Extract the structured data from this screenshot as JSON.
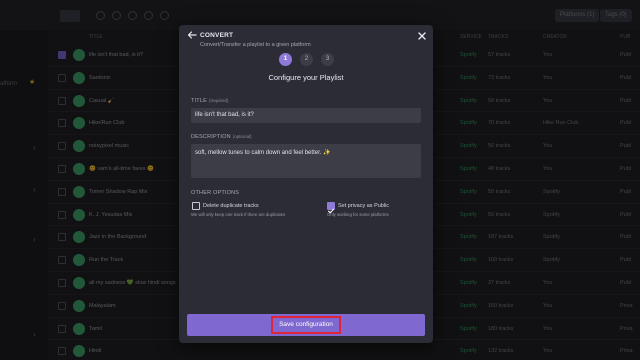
{
  "background": {
    "topbar": {
      "pills": [
        "Platforms (1)",
        "Tags (0)"
      ]
    },
    "sidebar": {
      "item": "atform"
    },
    "columns": [
      "TITLE",
      "SERVICE",
      "TRACKS",
      "CREATOR",
      "PUB"
    ],
    "rows": [
      {
        "name": "life isn't that bad, is it?",
        "platform": "Spotify",
        "tracks": "57 tracks",
        "creator": "You",
        "pub": "Publ",
        "checked": true
      },
      {
        "name": "Sardonic",
        "platform": "Spotify",
        "tracks": "73 tracks",
        "creator": "You",
        "pub": "Publ",
        "checked": false
      },
      {
        "name": "Casual 🧹",
        "platform": "Spotify",
        "tracks": "58 tracks",
        "creator": "You",
        "pub": "Publ",
        "checked": false
      },
      {
        "name": "Hike/Run Club",
        "platform": "Spotify",
        "tracks": "70 tracks",
        "creator": "Hike Run Club",
        "pub": "Publ",
        "checked": false
      },
      {
        "name": "noisypixel music",
        "platform": "Spotify",
        "tracks": "56 tracks",
        "creator": "You",
        "pub": "Publ",
        "checked": false
      },
      {
        "name": "😊 vam's all-time faves 😊",
        "platform": "Spotify",
        "tracks": "48 tracks",
        "creator": "You",
        "pub": "Publ",
        "checked": false
      },
      {
        "name": "Tomer Shadow Rap Mix",
        "platform": "Spotify",
        "tracks": "50 tracks",
        "creator": "Spotify",
        "pub": "Publ",
        "checked": false
      },
      {
        "name": "K. J. Yesudas Mix",
        "platform": "Spotify",
        "tracks": "50 tracks",
        "creator": "Spotify",
        "pub": "Publ",
        "checked": false
      },
      {
        "name": "Jazz in the Background",
        "platform": "Spotify",
        "tracks": "187 tracks",
        "creator": "Spotify",
        "pub": "Publ",
        "checked": false
      },
      {
        "name": "Run the Track",
        "platform": "Spotify",
        "tracks": "100 tracks",
        "creator": "Spotify",
        "pub": "Publ",
        "checked": false
      },
      {
        "name": "all my sadness 💚 slow hindi songs",
        "platform": "Spotify",
        "tracks": "37 tracks",
        "creator": "You",
        "pub": "Publ",
        "checked": false
      },
      {
        "name": "Malayalam",
        "platform": "Spotify",
        "tracks": "160 tracks",
        "creator": "You",
        "pub": "Priva",
        "checked": false
      },
      {
        "name": "Tamil",
        "platform": "Spotify",
        "tracks": "180 tracks",
        "creator": "You",
        "pub": "Priva",
        "checked": false
      },
      {
        "name": "Hindi",
        "platform": "Spotify",
        "tracks": "132 tracks",
        "creator": "You",
        "pub": "Priva",
        "checked": false
      }
    ]
  },
  "modal": {
    "title": "CONVERT",
    "subtitle": "Convert/Transfer a playlist to a given platform",
    "steps": [
      "1",
      "2",
      "3"
    ],
    "active_step": 1,
    "section_title": "Configure your Playlist",
    "title_field": {
      "label": "TITLE",
      "hint": "(required)",
      "value": "life isn't that bad, is it?"
    },
    "description_field": {
      "label": "DESCRIPTION",
      "hint": "(optional)",
      "value": "soft, mellow tunes to calm down and feel better. ✨"
    },
    "options_label": "OTHER OPTIONS",
    "options": [
      {
        "label": "Delete duplicate tracks",
        "description": "We will only keep one track if there are duplicates",
        "checked": false
      },
      {
        "label": "Set privacy as Public",
        "description": "Only working for some platforms",
        "checked": true
      }
    ],
    "save_label": "Save configuration",
    "colors": {
      "accent": "#8f7ad8",
      "button_bar": "#7f68cf",
      "highlight": "#e0253a"
    }
  }
}
